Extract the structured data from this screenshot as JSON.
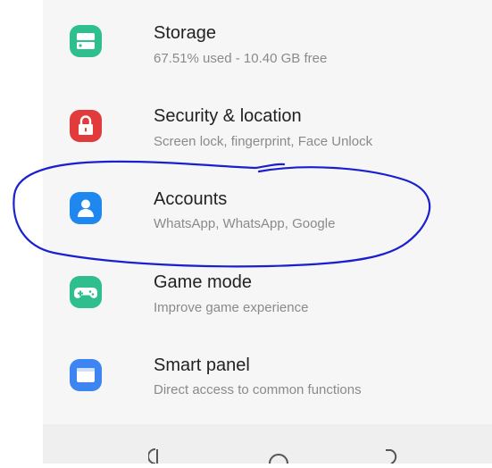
{
  "settings": {
    "items": [
      {
        "title": "Storage",
        "subtitle": "67.51% used - 10.40 GB free",
        "icon": "storage-icon",
        "color": "#2fbf8e"
      },
      {
        "title": "Security & location",
        "subtitle": "Screen lock, fingerprint, Face Unlock",
        "icon": "lock-icon",
        "color": "#e23b3b"
      },
      {
        "title": "Accounts",
        "subtitle": "WhatsApp, WhatsApp, Google",
        "icon": "account-icon",
        "color": "#1e88f0"
      },
      {
        "title": "Game mode",
        "subtitle": "Improve game experience",
        "icon": "gamepad-icon",
        "color": "#2fbf8e"
      },
      {
        "title": "Smart panel",
        "subtitle": "Direct access to common functions",
        "icon": "panel-icon",
        "color": "#3d86f2"
      }
    ]
  },
  "navbar": {
    "buttons": [
      "recent-apps-icon",
      "home-icon",
      "back-icon"
    ]
  },
  "annotation": {
    "stroke_color": "#1a1fd0"
  }
}
